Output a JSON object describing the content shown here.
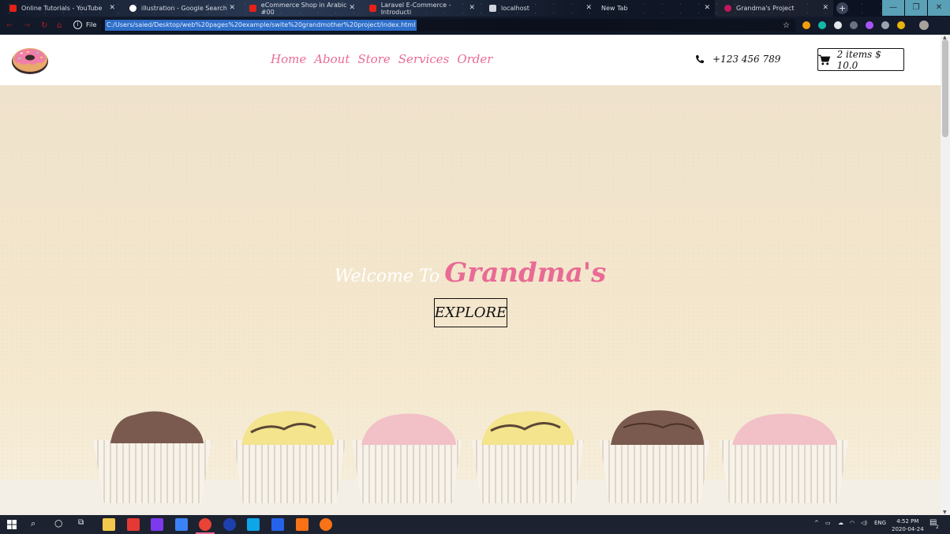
{
  "browser": {
    "tabs": [
      {
        "title": "Online Tutorials - YouTube",
        "favicon": "youtube-icon",
        "color": "#e62117"
      },
      {
        "title": "illustration - Google Search",
        "favicon": "google-icon",
        "color": "#ffffff"
      },
      {
        "title": "eCommerce Shop in Arabic #00",
        "favicon": "youtube-icon",
        "color": "#e62117"
      },
      {
        "title": "Laravel E-Commerce - Introducti",
        "favicon": "youtube-icon",
        "color": "#e62117"
      },
      {
        "title": "localhost",
        "favicon": "page-icon",
        "color": "#cfd4de"
      },
      {
        "title": "New Tab",
        "favicon": "none",
        "color": "transparent"
      },
      {
        "title": "Grandma's Project",
        "favicon": "donut-icon",
        "color": "#c2185b"
      }
    ],
    "new_tab_label": "+",
    "file_label": "File",
    "url": "C:/Users/saied/Desktop/web%20pages%20example/swite%20grandmother%20project/index.html"
  },
  "site": {
    "nav": [
      "Home",
      "About",
      "Store",
      "Services",
      "Order"
    ],
    "phone": "+123 456 789",
    "cart_label": "2 items $ 10.0",
    "hero": {
      "welcome": "Welcome To",
      "brand": "Grandma's",
      "button": "EXPLORE"
    },
    "colors": {
      "accent": "#e96a95",
      "hero_bg": "#f3e6cc"
    }
  },
  "taskbar": {
    "language": "ENG",
    "time": "4:52 PM",
    "date": "2020-04-24",
    "notification_count": "2"
  }
}
